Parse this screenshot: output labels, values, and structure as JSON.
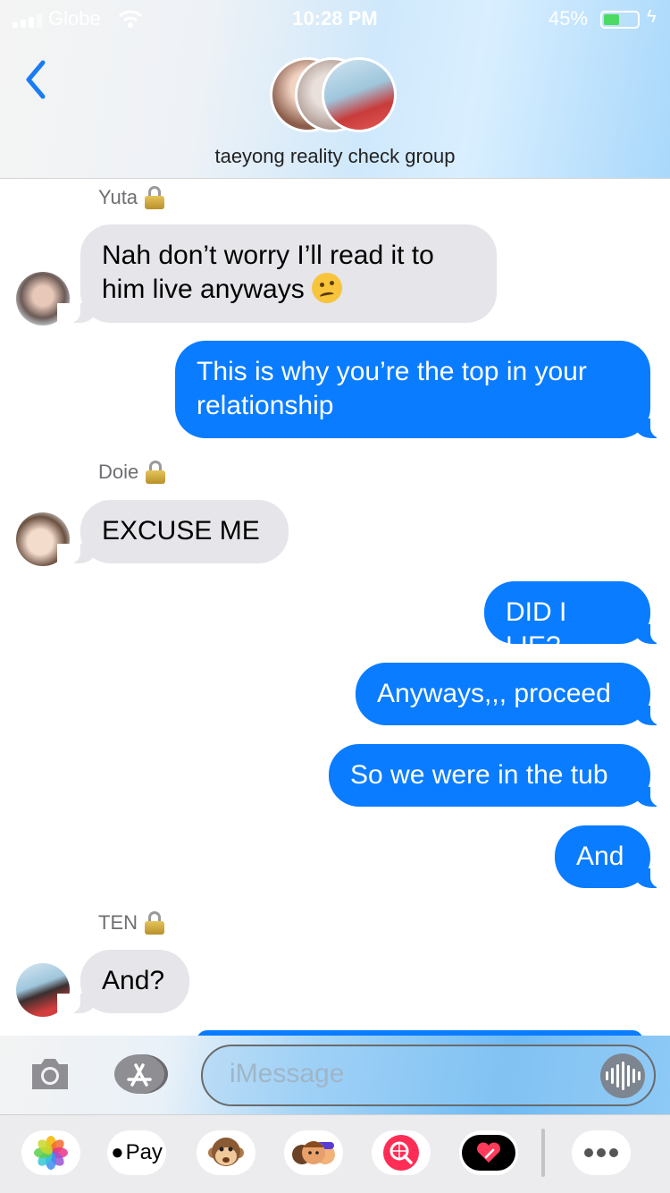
{
  "status_bar": {
    "carrier": "Globe",
    "time": "10:28 PM",
    "battery": "45%"
  },
  "header": {
    "group_name": "taeyong reality check group"
  },
  "messages": [
    {
      "sender": "Yuta",
      "text": "Nah don’t worry I’ll read it to him live anyways"
    },
    {
      "text": "This is why you’re the top in your relationship"
    },
    {
      "sender": "Doie",
      "text": "EXCUSE ME"
    },
    {
      "text": "DID I LIE?"
    },
    {
      "text": "Anyways,,, proceed"
    },
    {
      "text": "So we were in the tub"
    },
    {
      "text": "And"
    },
    {
      "sender": "TEN",
      "text": "And?"
    }
  ],
  "compose": {
    "placeholder": "iMessage"
  },
  "drawer": {
    "apple_pay_label": "Pay"
  },
  "icons": [
    "back-chevron-icon",
    "camera-icon",
    "app-store-icon",
    "audio-waveform-icon",
    "photos-icon",
    "apple-pay-icon",
    "monkey-animoji-icon",
    "memoji-icon",
    "image-search-icon",
    "digital-touch-icon",
    "more-icon",
    "lock-icon",
    "wifi-icon",
    "battery-icon"
  ],
  "colors": {
    "outgoing": "#0a7cff",
    "incoming": "#e5e5ea",
    "accent": "#1a7cf5"
  }
}
